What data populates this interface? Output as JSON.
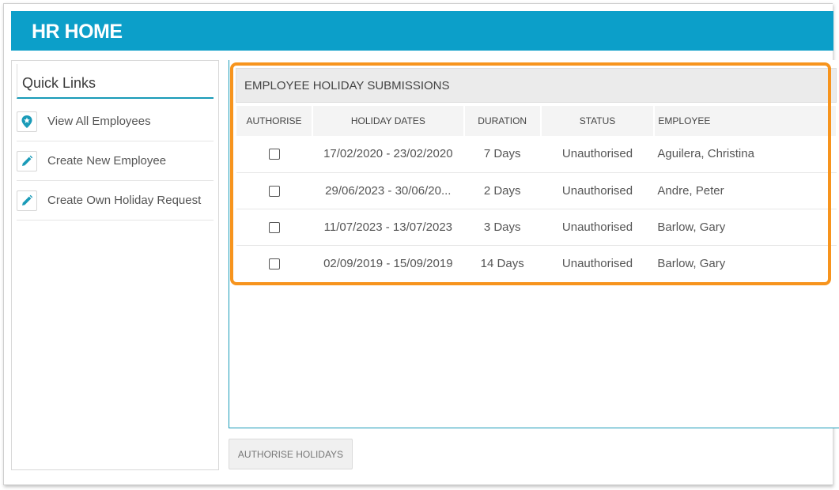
{
  "header": {
    "title": "HR HOME"
  },
  "quick_links": {
    "title": "Quick Links",
    "items": [
      {
        "label": "View All Employees",
        "icon": "location-star-icon"
      },
      {
        "label": "Create New Employee",
        "icon": "pencil-icon"
      },
      {
        "label": "Create Own Holiday Request",
        "icon": "pencil-icon"
      }
    ]
  },
  "submissions": {
    "title": "EMPLOYEE HOLIDAY SUBMISSIONS",
    "columns": [
      "AUTHORISE",
      "HOLIDAY DATES",
      "DURATION",
      "STATUS",
      "EMPLOYEE"
    ],
    "rows": [
      {
        "dates": "17/02/2020 - 23/02/2020",
        "duration": "7 Days",
        "status": "Unauthorised",
        "employee": "Aguilera, Christina",
        "checked": false
      },
      {
        "dates": "29/06/2023 - 30/06/20...",
        "duration": "2 Days",
        "status": "Unauthorised",
        "employee": "Andre, Peter",
        "checked": false
      },
      {
        "dates": "11/07/2023 - 13/07/2023",
        "duration": "3 Days",
        "status": "Unauthorised",
        "employee": "Barlow, Gary",
        "checked": false
      },
      {
        "dates": "02/09/2019 - 15/09/2019",
        "duration": "14 Days",
        "status": "Unauthorised",
        "employee": "Barlow, Gary",
        "checked": false
      }
    ]
  },
  "actions": {
    "authorise_label": "AUTHORISE HOLIDAYS"
  },
  "colors": {
    "accent": "#0c9fc9",
    "highlight": "#f7941d"
  }
}
